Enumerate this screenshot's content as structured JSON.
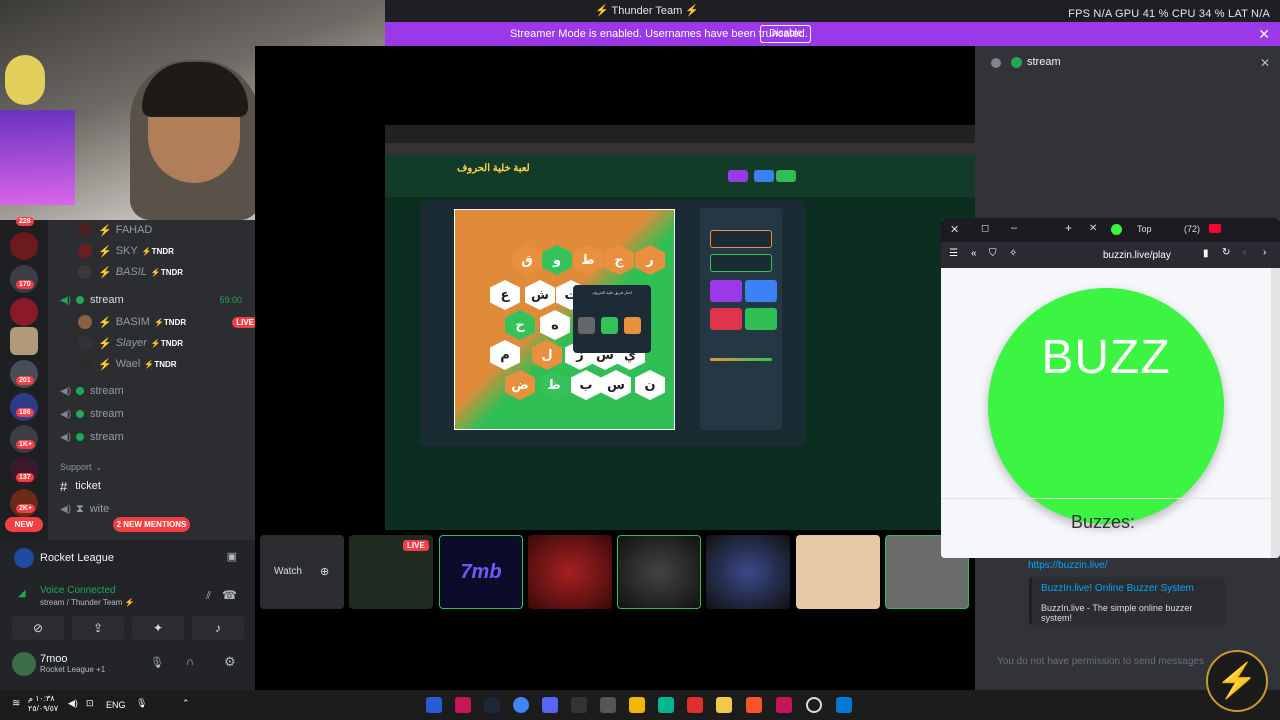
{
  "topbar": {
    "title": "⚡ Thunder Team ⚡",
    "stats": "FPS N/A   GPU 41 %   CPU 34 %   LAT N/A"
  },
  "banner": {
    "message": "Streamer Mode is enabled. Usernames have been truncated.",
    "disable_label": "Disable"
  },
  "guilds": {
    "badges": [
      "228",
      "170",
      "201",
      "186",
      "1K+",
      "137",
      "2K+"
    ],
    "new_label": "NEW"
  },
  "channels": {
    "members": [
      {
        "name": "FAHAD",
        "tag": ""
      },
      {
        "name": "SKY",
        "tag": "⚡TNDR"
      },
      {
        "name": "BASIL",
        "tag": "⚡TNDR"
      }
    ],
    "voice_channel": {
      "name": "stream",
      "time": "59:00"
    },
    "voice_members": [
      {
        "name": "BASIM",
        "tag": "⚡TNDR",
        "live": "LIVE"
      },
      {
        "name": "Slayer",
        "tag": "⚡TNDR"
      },
      {
        "name": "Wael",
        "tag": "⚡TNDR"
      }
    ],
    "voice_streams": [
      "stream",
      "stream",
      "stream"
    ],
    "category": "Support",
    "text_channel": "ticket",
    "text_channel2": "wite",
    "mentions_label": "2 NEW MENTIONS"
  },
  "bottom": {
    "game": "Rocket League",
    "voice_status": "Voice Connected",
    "voice_sub": "stream / Thunder Team ⚡",
    "username": "7moo",
    "user_sub": "Rocket League +1"
  },
  "game": {
    "logo": "لعبة خلية الحروف",
    "popup_title": "اختار فريق خلية الحروف",
    "rows": [
      [
        "ر",
        "ج",
        "ط",
        "و",
        "ق"
      ],
      [
        "ت",
        "ش",
        "ع"
      ],
      [
        "ه",
        "ح"
      ],
      [
        "ي",
        "س",
        "ز",
        "ل",
        "م"
      ],
      [
        "ن",
        "س",
        "ب",
        "ظ",
        "ض"
      ]
    ]
  },
  "thumbs": {
    "watch_label": "Watch",
    "live_label": "LIVE",
    "channel_label": "7mb"
  },
  "right": {
    "header": "stream",
    "link": "https://buzzin.live/",
    "embed_title": "BuzzIn.live! Online Buzzer System",
    "embed_desc": "BuzzIn.live - The simple online buzzer system!",
    "no_permission": "You do not have permission to send messages"
  },
  "buzz": {
    "tab_label": "Top",
    "tab_count": "(72)",
    "url": "buzzin.live/play",
    "button_label": "BUZZ",
    "buzzes_label": "Buzzes:"
  },
  "taskbar": {
    "lang": "ENG",
    "time": "١٠:٣٨ م",
    "date": "٢٥/٠٩/٥٧"
  }
}
